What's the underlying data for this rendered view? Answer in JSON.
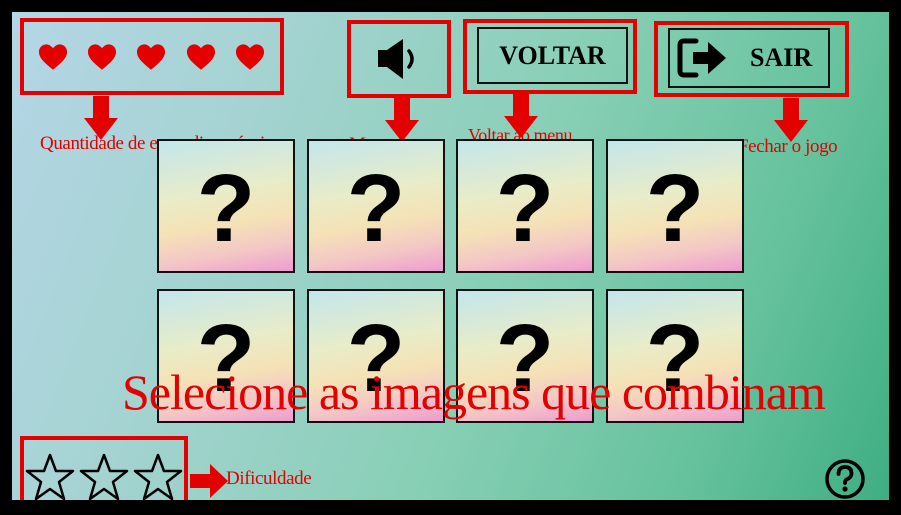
{
  "hud": {
    "lives": [
      1,
      2,
      3,
      4,
      5
    ],
    "lives_color": "#e30000",
    "sound_icon": "speaker-volume-icon",
    "back_label": "VOLTAR",
    "exit_label": "SAIR",
    "exit_icon": "exit-arrow-icon",
    "help_icon": "help-question-icon"
  },
  "annotations": {
    "lives": "Quantidade de erros disponíveis",
    "mute": "Mutar o som",
    "back": "Voltar ao menu",
    "exit": "Fechar o jogo",
    "difficulty": "Dificuldade"
  },
  "cards": [
    {
      "face": "?"
    },
    {
      "face": "?"
    },
    {
      "face": "?"
    },
    {
      "face": "?"
    },
    {
      "face": "?"
    },
    {
      "face": "?"
    },
    {
      "face": "?"
    },
    {
      "face": "?"
    }
  ],
  "instruction": "Selecione as imagens que combinam",
  "difficulty": {
    "stars_total": 3,
    "stars_filled": 0
  },
  "accent_color": "#e30000"
}
